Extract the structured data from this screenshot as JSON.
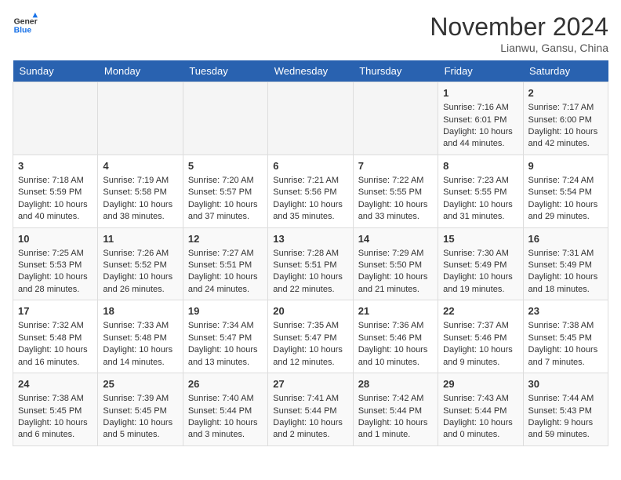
{
  "header": {
    "logo_line1": "General",
    "logo_line2": "Blue",
    "month": "November 2024",
    "location": "Lianwu, Gansu, China"
  },
  "days_of_week": [
    "Sunday",
    "Monday",
    "Tuesday",
    "Wednesday",
    "Thursday",
    "Friday",
    "Saturday"
  ],
  "weeks": [
    [
      {
        "day": "",
        "info": ""
      },
      {
        "day": "",
        "info": ""
      },
      {
        "day": "",
        "info": ""
      },
      {
        "day": "",
        "info": ""
      },
      {
        "day": "",
        "info": ""
      },
      {
        "day": "1",
        "info": "Sunrise: 7:16 AM\nSunset: 6:01 PM\nDaylight: 10 hours and 44 minutes."
      },
      {
        "day": "2",
        "info": "Sunrise: 7:17 AM\nSunset: 6:00 PM\nDaylight: 10 hours and 42 minutes."
      }
    ],
    [
      {
        "day": "3",
        "info": "Sunrise: 7:18 AM\nSunset: 5:59 PM\nDaylight: 10 hours and 40 minutes."
      },
      {
        "day": "4",
        "info": "Sunrise: 7:19 AM\nSunset: 5:58 PM\nDaylight: 10 hours and 38 minutes."
      },
      {
        "day": "5",
        "info": "Sunrise: 7:20 AM\nSunset: 5:57 PM\nDaylight: 10 hours and 37 minutes."
      },
      {
        "day": "6",
        "info": "Sunrise: 7:21 AM\nSunset: 5:56 PM\nDaylight: 10 hours and 35 minutes."
      },
      {
        "day": "7",
        "info": "Sunrise: 7:22 AM\nSunset: 5:55 PM\nDaylight: 10 hours and 33 minutes."
      },
      {
        "day": "8",
        "info": "Sunrise: 7:23 AM\nSunset: 5:55 PM\nDaylight: 10 hours and 31 minutes."
      },
      {
        "day": "9",
        "info": "Sunrise: 7:24 AM\nSunset: 5:54 PM\nDaylight: 10 hours and 29 minutes."
      }
    ],
    [
      {
        "day": "10",
        "info": "Sunrise: 7:25 AM\nSunset: 5:53 PM\nDaylight: 10 hours and 28 minutes."
      },
      {
        "day": "11",
        "info": "Sunrise: 7:26 AM\nSunset: 5:52 PM\nDaylight: 10 hours and 26 minutes."
      },
      {
        "day": "12",
        "info": "Sunrise: 7:27 AM\nSunset: 5:51 PM\nDaylight: 10 hours and 24 minutes."
      },
      {
        "day": "13",
        "info": "Sunrise: 7:28 AM\nSunset: 5:51 PM\nDaylight: 10 hours and 22 minutes."
      },
      {
        "day": "14",
        "info": "Sunrise: 7:29 AM\nSunset: 5:50 PM\nDaylight: 10 hours and 21 minutes."
      },
      {
        "day": "15",
        "info": "Sunrise: 7:30 AM\nSunset: 5:49 PM\nDaylight: 10 hours and 19 minutes."
      },
      {
        "day": "16",
        "info": "Sunrise: 7:31 AM\nSunset: 5:49 PM\nDaylight: 10 hours and 18 minutes."
      }
    ],
    [
      {
        "day": "17",
        "info": "Sunrise: 7:32 AM\nSunset: 5:48 PM\nDaylight: 10 hours and 16 minutes."
      },
      {
        "day": "18",
        "info": "Sunrise: 7:33 AM\nSunset: 5:48 PM\nDaylight: 10 hours and 14 minutes."
      },
      {
        "day": "19",
        "info": "Sunrise: 7:34 AM\nSunset: 5:47 PM\nDaylight: 10 hours and 13 minutes."
      },
      {
        "day": "20",
        "info": "Sunrise: 7:35 AM\nSunset: 5:47 PM\nDaylight: 10 hours and 12 minutes."
      },
      {
        "day": "21",
        "info": "Sunrise: 7:36 AM\nSunset: 5:46 PM\nDaylight: 10 hours and 10 minutes."
      },
      {
        "day": "22",
        "info": "Sunrise: 7:37 AM\nSunset: 5:46 PM\nDaylight: 10 hours and 9 minutes."
      },
      {
        "day": "23",
        "info": "Sunrise: 7:38 AM\nSunset: 5:45 PM\nDaylight: 10 hours and 7 minutes."
      }
    ],
    [
      {
        "day": "24",
        "info": "Sunrise: 7:38 AM\nSunset: 5:45 PM\nDaylight: 10 hours and 6 minutes."
      },
      {
        "day": "25",
        "info": "Sunrise: 7:39 AM\nSunset: 5:45 PM\nDaylight: 10 hours and 5 minutes."
      },
      {
        "day": "26",
        "info": "Sunrise: 7:40 AM\nSunset: 5:44 PM\nDaylight: 10 hours and 3 minutes."
      },
      {
        "day": "27",
        "info": "Sunrise: 7:41 AM\nSunset: 5:44 PM\nDaylight: 10 hours and 2 minutes."
      },
      {
        "day": "28",
        "info": "Sunrise: 7:42 AM\nSunset: 5:44 PM\nDaylight: 10 hours and 1 minute."
      },
      {
        "day": "29",
        "info": "Sunrise: 7:43 AM\nSunset: 5:44 PM\nDaylight: 10 hours and 0 minutes."
      },
      {
        "day": "30",
        "info": "Sunrise: 7:44 AM\nSunset: 5:43 PM\nDaylight: 9 hours and 59 minutes."
      }
    ]
  ]
}
